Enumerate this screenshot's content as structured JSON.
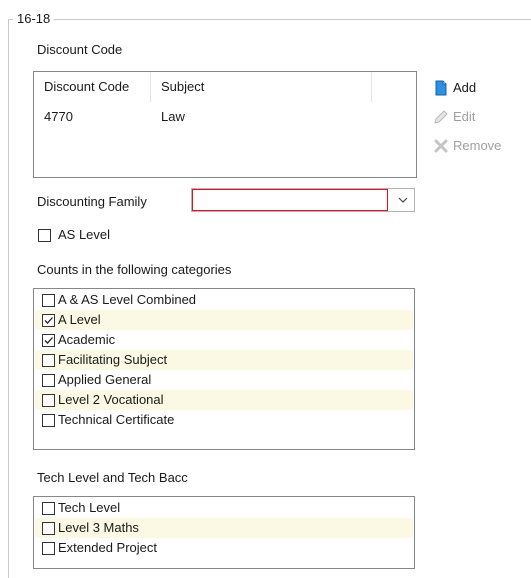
{
  "group": {
    "title": "16-18"
  },
  "discount_code": {
    "section_label": "Discount Code",
    "columns": [
      "Discount Code",
      "Subject"
    ],
    "rows": [
      {
        "code": "4770",
        "subject": "Law"
      }
    ],
    "actions": {
      "add": "Add",
      "edit": "Edit",
      "remove": "Remove"
    }
  },
  "discounting_family": {
    "label": "Discounting Family",
    "value": ""
  },
  "as_level": {
    "label": "AS Level",
    "checked": false
  },
  "categories": {
    "label": "Counts in the following categories",
    "items": [
      {
        "label": "A & AS Level Combined",
        "checked": false
      },
      {
        "label": "A Level",
        "checked": true
      },
      {
        "label": "Academic",
        "checked": true
      },
      {
        "label": "Facilitating Subject",
        "checked": false
      },
      {
        "label": "Applied General",
        "checked": false
      },
      {
        "label": "Level 2 Vocational",
        "checked": false
      },
      {
        "label": "Technical Certificate",
        "checked": false
      }
    ]
  },
  "tech": {
    "label": "Tech Level and Tech Bacc",
    "items": [
      {
        "label": "Tech Level",
        "checked": false
      },
      {
        "label": "Level 3 Maths",
        "checked": false
      },
      {
        "label": "Extended Project",
        "checked": false
      }
    ]
  },
  "colors": {
    "alt_row": "#fbf9e4",
    "combo_error_border": "#e81123",
    "list_border": "#828790"
  }
}
